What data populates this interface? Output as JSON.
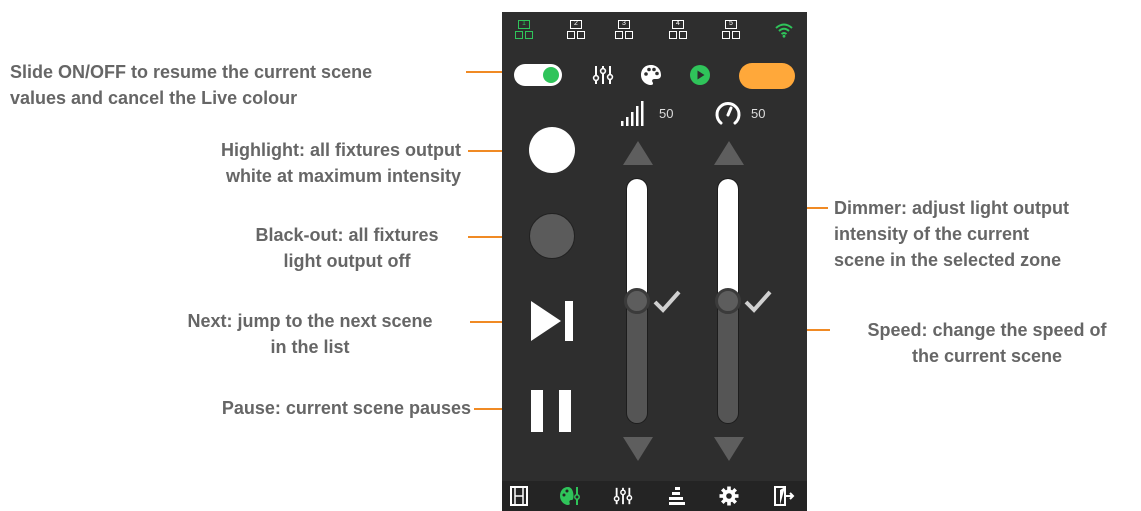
{
  "annotations": {
    "slide": [
      "Slide ON/OFF to resume the current scene",
      "values and cancel the Live colour"
    ],
    "highlight": [
      "Highlight: all fixtures output",
      "white at maximum intensity"
    ],
    "blackout": [
      "Black-out: all fixtures",
      "light output off"
    ],
    "next": [
      "Next: jump to the next scene",
      "in the list"
    ],
    "pause": [
      "Pause: current scene pauses"
    ],
    "dimmer": [
      "Dimmer: adjust light output",
      "intensity of the current",
      "scene in the selected zone"
    ],
    "speed": [
      "Speed: change the speed of",
      "the current scene"
    ]
  },
  "app": {
    "zones": [
      {
        "label": "1",
        "active": true
      },
      {
        "label": "2",
        "active": false
      },
      {
        "label": "3",
        "active": false
      },
      {
        "label": "4",
        "active": false
      },
      {
        "label": "5",
        "active": false
      }
    ],
    "toggle_on": true,
    "dimmer": {
      "value": "50",
      "level": 0.5
    },
    "speed": {
      "value": "50",
      "level": 0.5
    },
    "colors": {
      "accent": "#2fc45a",
      "orange": "#ffa83a",
      "callout": "#f08a24",
      "panel": "#2e2e2e"
    },
    "icons": {
      "top": [
        "zone-1-icon",
        "zone-2-icon",
        "zone-3-icon",
        "zone-4-icon",
        "zone-5-icon",
        "wifi-icon"
      ],
      "toolbar": [
        "sliders-icon",
        "palette-icon",
        "play-icon"
      ],
      "bottom": [
        "film-icon",
        "palette-settings-icon",
        "sliders-icon",
        "equalizer-icon",
        "gear-icon",
        "exit-icon"
      ]
    }
  }
}
